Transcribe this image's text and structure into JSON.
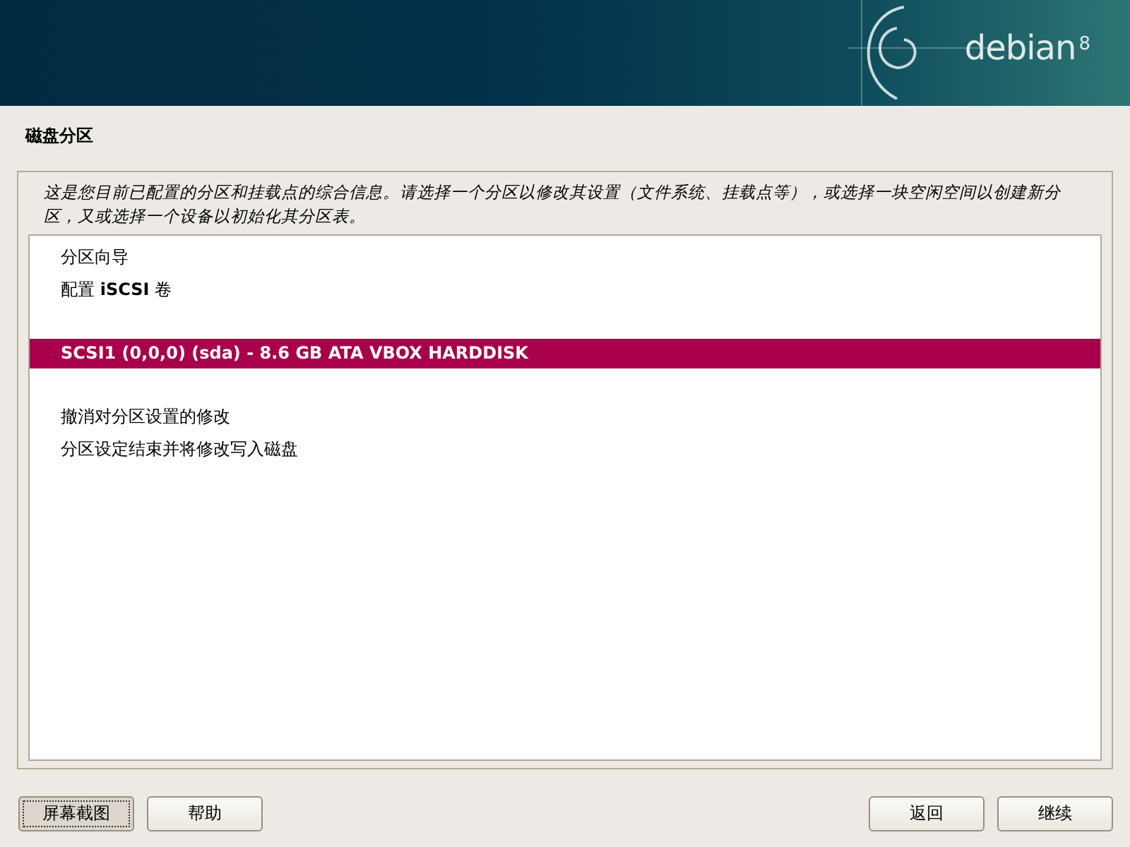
{
  "header": {
    "logo_text": "debian",
    "logo_version": "8"
  },
  "title": "磁盘分区",
  "description": "这是您目前已配置的分区和挂载点的综合信息。请选择一个分区以修改其设置（文件系统、挂载点等），或选择一块空闲空间以创建新分区，又或选择一个设备以初始化其分区表。",
  "groups": [
    [
      {
        "label": "分区向导",
        "selected": false
      },
      {
        "label": "配置 **iSCSI** 卷",
        "selected": false
      }
    ],
    [
      {
        "label": "SCSI1 (0,0,0) (sda) - 8.6 GB ATA VBOX HARDDISK",
        "selected": true
      }
    ],
    [
      {
        "label": "撤消对分区设置的修改",
        "selected": false
      },
      {
        "label": "分区设定结束并将修改写入磁盘",
        "selected": false
      }
    ]
  ],
  "buttons_left": [
    "屏幕截图",
    "帮助"
  ],
  "buttons_right": [
    "返回",
    "继续"
  ]
}
